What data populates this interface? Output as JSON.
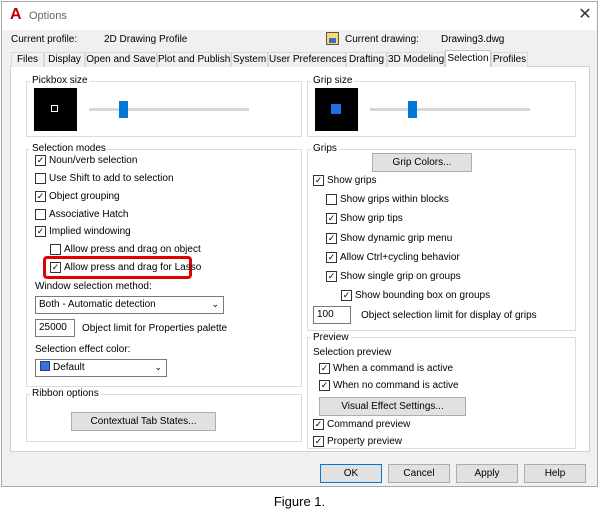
{
  "window": {
    "title": "Options",
    "close_icon": "close-icon",
    "app_icon": "autocad-logo-icon"
  },
  "header": {
    "current_profile_label": "Current profile:",
    "current_profile_value": "2D Drawing Profile",
    "current_drawing_label": "Current drawing:",
    "current_drawing_value": "Drawing3.dwg"
  },
  "tabs": [
    "Files",
    "Display",
    "Open and Save",
    "Plot and Publish",
    "System",
    "User Preferences",
    "Drafting",
    "3D Modeling",
    "Selection",
    "Profiles"
  ],
  "active_tab": "Selection",
  "pickbox": {
    "label": "Pickbox size",
    "level": 0.2
  },
  "selection_modes": {
    "label": "Selection modes",
    "items": [
      {
        "label": "Noun/verb selection",
        "checked": true
      },
      {
        "label": "Use Shift to add to selection",
        "checked": false
      },
      {
        "label": "Object grouping",
        "checked": true
      },
      {
        "label": "Associative Hatch",
        "checked": false
      },
      {
        "label": "Implied windowing",
        "checked": true
      },
      {
        "label": "Allow press and drag on object",
        "checked": false
      },
      {
        "label": "Allow press and drag for Lasso",
        "checked": true
      }
    ],
    "window_method_label": "Window selection method:",
    "window_method_value": "Both - Automatic detection",
    "object_limit_value": "25000",
    "object_limit_label": "Object limit for Properties palette",
    "effect_color_label": "Selection effect color:",
    "effect_color_value": "Default",
    "effect_color_swatch": "#3c6fd8"
  },
  "ribbon": {
    "label": "Ribbon options",
    "contextual_button": "Contextual Tab States..."
  },
  "grip_size": {
    "label": "Grip size",
    "level": 0.25
  },
  "grips": {
    "label": "Grips",
    "colors_button": "Grip Colors...",
    "items": [
      {
        "label": "Show grips",
        "checked": true
      },
      {
        "label": "Show grips within blocks",
        "checked": false
      },
      {
        "label": "Show grip tips",
        "checked": true
      },
      {
        "label": "Show dynamic grip menu",
        "checked": true
      },
      {
        "label": "Allow Ctrl+cycling behavior",
        "checked": true
      },
      {
        "label": "Show single grip on groups",
        "checked": true
      },
      {
        "label": "Show bounding box on groups",
        "checked": true
      }
    ],
    "limit_value": "100",
    "limit_label": "Object selection limit for display of grips"
  },
  "preview": {
    "label": "Preview",
    "selection_preview_label": "Selection preview",
    "items": [
      {
        "label": "When a command is active",
        "checked": true
      },
      {
        "label": "When no command is active",
        "checked": true
      }
    ],
    "visual_effect_button": "Visual Effect Settings...",
    "command_preview": {
      "label": "Command preview",
      "checked": true
    },
    "property_preview": {
      "label": "Property preview",
      "checked": true
    }
  },
  "footer": {
    "ok": "OK",
    "cancel": "Cancel",
    "apply": "Apply",
    "help": "Help"
  },
  "caption": "Figure 1."
}
